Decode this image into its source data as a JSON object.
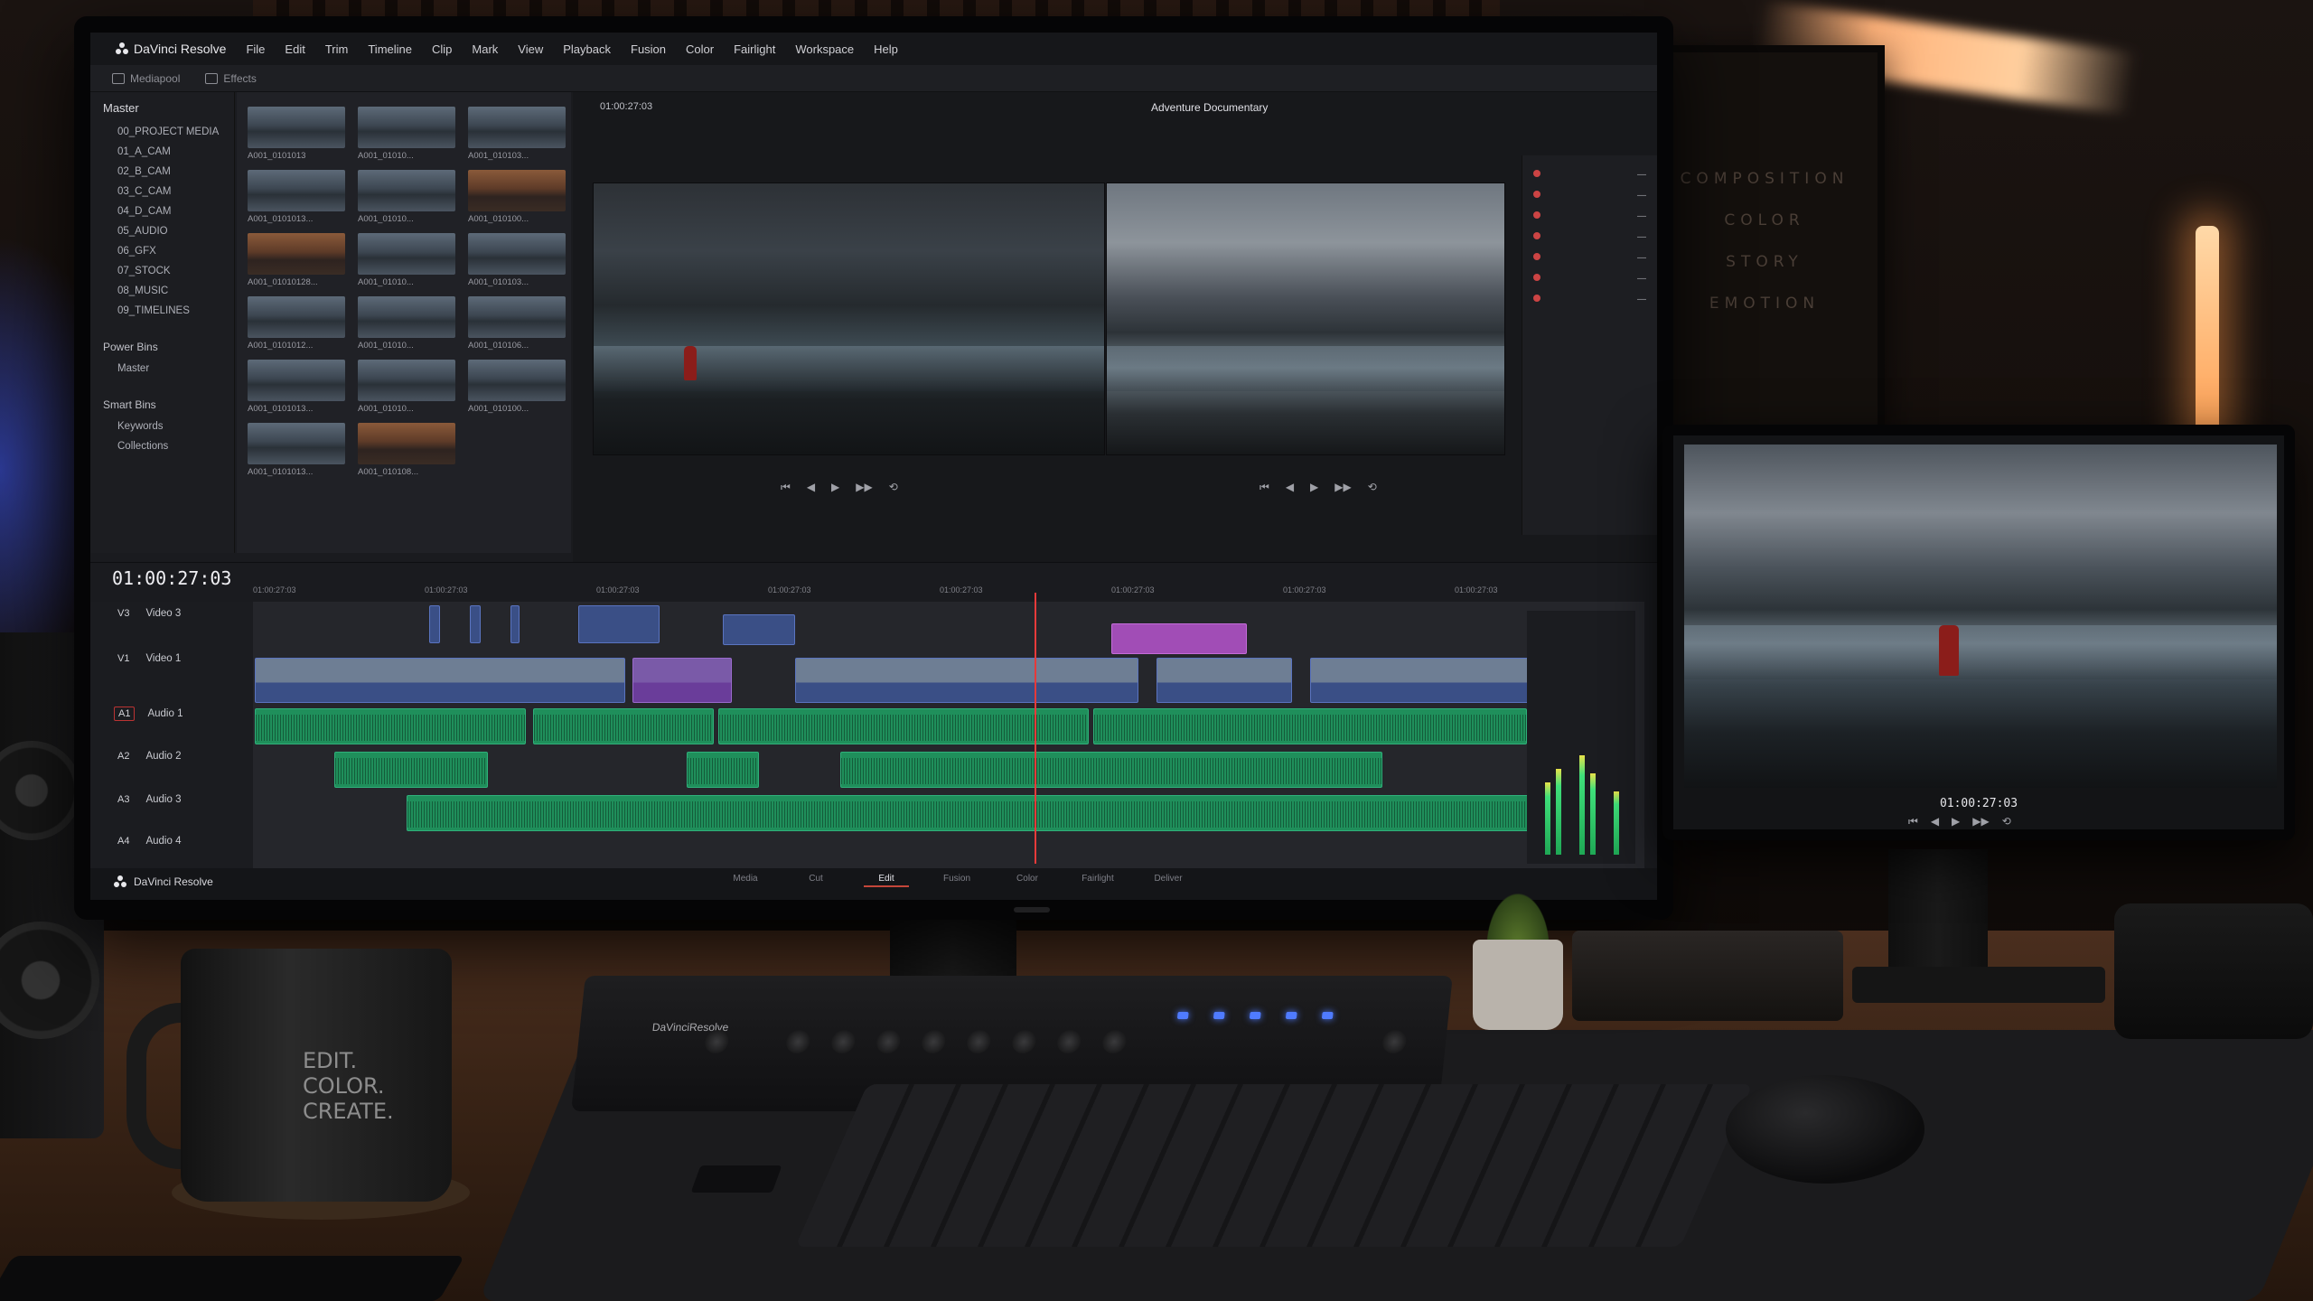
{
  "app": {
    "name": "DaVinci Resolve",
    "menu": [
      "File",
      "Edit",
      "Trim",
      "Timeline",
      "Clip",
      "Mark",
      "View",
      "Playback",
      "Fusion",
      "Color",
      "Fairlight",
      "Workspace",
      "Help"
    ]
  },
  "toolbar": {
    "media_pool": "Mediapool",
    "effects": "Effects"
  },
  "media_pool": {
    "root": "Master",
    "bins": [
      "00_PROJECT MEDIA",
      "01_A_CAM",
      "02_B_CAM",
      "03_C_CAM",
      "04_D_CAM",
      "05_AUDIO",
      "06_GFX",
      "07_STOCK",
      "08_MUSIC",
      "09_TIMELINES"
    ],
    "power_bins_title": "Power Bins",
    "power_bins": [
      "Master"
    ],
    "smart_bins_title": "Smart Bins",
    "smart_bins": [
      "Keywords",
      "Collections"
    ]
  },
  "clips": [
    {
      "name": "A001_0101013",
      "tone": "cool"
    },
    {
      "name": "A001_01010...",
      "tone": "cool"
    },
    {
      "name": "A001_010103...",
      "tone": "cool"
    },
    {
      "name": "A001_0101013...",
      "tone": "cool"
    },
    {
      "name": "A001_01010...",
      "tone": "cool"
    },
    {
      "name": "A001_010100...",
      "tone": "warm"
    },
    {
      "name": "A001_01010128...",
      "tone": "warm"
    },
    {
      "name": "A001_01010...",
      "tone": "cool"
    },
    {
      "name": "A001_010103...",
      "tone": "cool"
    },
    {
      "name": "A001_0101012...",
      "tone": "cool"
    },
    {
      "name": "A001_01010...",
      "tone": "cool"
    },
    {
      "name": "A001_010106...",
      "tone": "cool"
    },
    {
      "name": "A001_0101013...",
      "tone": "cool"
    },
    {
      "name": "A001_01010...",
      "tone": "cool"
    },
    {
      "name": "A001_010100...",
      "tone": "cool"
    },
    {
      "name": "A001_0101013...",
      "tone": "cool"
    },
    {
      "name": "A001_010108...",
      "tone": "warm"
    }
  ],
  "viewer": {
    "project_title": "Adventure Documentary",
    "source_timecode": "01:00:27:03",
    "program_timecode": "01:00:27:03"
  },
  "timeline": {
    "timecode": "01:00:27:03",
    "ruler": [
      "01:00:27:03",
      "01:00:27:03",
      "01:00:27:03",
      "01:00:27:03",
      "01:00:27:03",
      "01:00:27:03",
      "01:00:27:03",
      "01:00:27:03"
    ],
    "tracks": [
      {
        "id": "V3",
        "name": "Video 3"
      },
      {
        "id": "V1",
        "name": "Video 1"
      },
      {
        "id": "A1",
        "name": "Audio 1"
      },
      {
        "id": "A2",
        "name": "Audio 2"
      },
      {
        "id": "A3",
        "name": "Audio 3"
      },
      {
        "id": "A4",
        "name": "Audio 4"
      }
    ]
  },
  "pages": [
    "Media",
    "Cut",
    "Edit",
    "Fusion",
    "Color",
    "Fairlight",
    "Deliver"
  ],
  "active_page": "Edit",
  "brand_footer": "DaVinci Resolve",
  "side_monitor": {
    "timecode": "01:00:27:03"
  },
  "poster": [
    "COMPOSITION",
    "COLOR",
    "STORY",
    "EMOTION"
  ],
  "mug_text": [
    "EDIT.",
    "COLOR.",
    "CREATE."
  ],
  "control_panel": {
    "label": "DaVinciResolve"
  },
  "colors": {
    "audio_clip": "#1f8f5b",
    "video_clip": "#3a4f86",
    "accent_red": "#e63a3a"
  }
}
